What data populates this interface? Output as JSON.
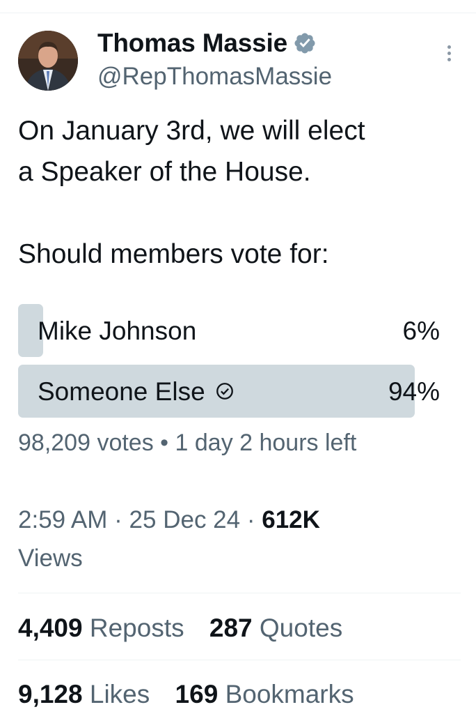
{
  "author": {
    "display_name": "Thomas Massie",
    "handle": "@RepThomasMassie",
    "verified_icon": "verified-badge-icon",
    "verified_color": "#829aab"
  },
  "tweet": {
    "lines": [
      "On January 3rd, we will elect",
      "a Speaker of the House.",
      "",
      "Should members vote for:"
    ]
  },
  "poll": {
    "options": [
      {
        "label": "Mike Johnson",
        "percent_label": "6%",
        "percent": 6,
        "winner": false
      },
      {
        "label": "Someone Else",
        "percent_label": "94%",
        "percent": 94,
        "winner": true
      }
    ],
    "meta": {
      "votes": "98,209 votes",
      "separator": "•",
      "time_left": "1 day 2 hours left"
    },
    "bar_color": "#cfd9de"
  },
  "timestamp": {
    "time": "2:59 AM",
    "date": "25 Dec 24",
    "views_count": "612K",
    "views_label": "Views",
    "separator": "·"
  },
  "stats": {
    "reposts": {
      "count": "4,409",
      "label": "Reposts"
    },
    "quotes": {
      "count": "287",
      "label": "Quotes"
    },
    "likes": {
      "count": "9,128",
      "label": "Likes"
    },
    "bookmarks": {
      "count": "169",
      "label": "Bookmarks"
    }
  },
  "colors": {
    "text_primary": "#0f1419",
    "text_secondary": "#536471",
    "divider": "#eff3f4"
  }
}
